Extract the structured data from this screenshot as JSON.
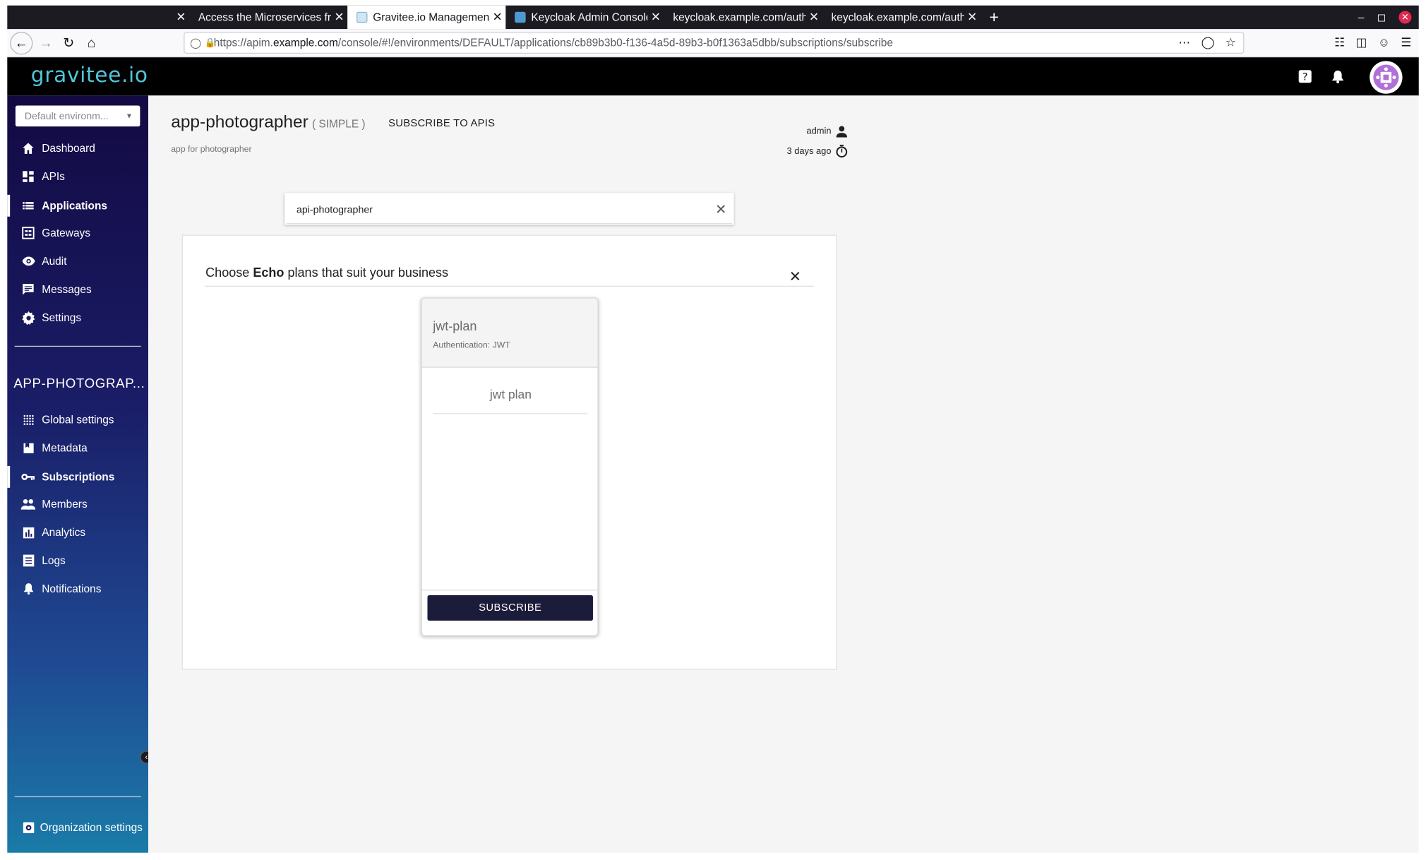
{
  "browser": {
    "tabs": [
      {
        "title": "",
        "active": false
      },
      {
        "title": "Access the Microservices fr",
        "active": false
      },
      {
        "title": "Gravitee.io Management",
        "active": true
      },
      {
        "title": "Keycloak Admin Console",
        "active": false
      },
      {
        "title": "keycloak.example.com/auth",
        "active": false
      },
      {
        "title": "keycloak.example.com/auth",
        "active": false
      }
    ],
    "url_prefix": "https://apim.",
    "url_host": "example.com",
    "url_path": "/console/#!/environments/DEFAULT/applications/cb89b3b0-f136-4a5d-89b3-b0f1363a5dbb/subscriptions/subscribe",
    "close_glyph": "✕",
    "new_tab_glyph": "+"
  },
  "header": {
    "brand": "gravitee.io",
    "colors": {
      "brand": "#51c6da",
      "header_bg": "#000000",
      "sidebar_top": "#130a43",
      "sidebar_bottom": "#1a7ba8",
      "primary_button": "#1b1b3a"
    }
  },
  "sidebar": {
    "environment": "Default environm...",
    "main_items": [
      {
        "label": "Dashboard",
        "icon": "home-icon"
      },
      {
        "label": "APIs",
        "icon": "dashboard-grid-icon"
      },
      {
        "label": "Applications",
        "icon": "list-icon",
        "active": true
      },
      {
        "label": "Gateways",
        "icon": "gateways-icon"
      },
      {
        "label": "Audit",
        "icon": "eye-icon"
      },
      {
        "label": "Messages",
        "icon": "message-icon"
      },
      {
        "label": "Settings",
        "icon": "gear-icon"
      }
    ],
    "app_section_title": "APP-PHOTOGRAP...",
    "app_items": [
      {
        "label": "Global settings",
        "icon": "dots-grid-icon"
      },
      {
        "label": "Metadata",
        "icon": "bookmark-icon"
      },
      {
        "label": "Subscriptions",
        "icon": "key-icon",
        "active": true
      },
      {
        "label": "Members",
        "icon": "people-icon"
      },
      {
        "label": "Analytics",
        "icon": "bar-chart-icon"
      },
      {
        "label": "Logs",
        "icon": "document-icon"
      },
      {
        "label": "Notifications",
        "icon": "bell-icon"
      }
    ],
    "org_settings": "Organization settings"
  },
  "app": {
    "name": "app-photographer",
    "type": "( SIMPLE )",
    "subscribe_link": "SUBSCRIBE TO APIS",
    "description": "app for photographer",
    "owner": "admin",
    "created": "3 days ago"
  },
  "search": {
    "value": "api-photographer"
  },
  "plans": {
    "heading_prefix": "Choose ",
    "api_name": "Echo",
    "heading_suffix": " plans that suit your business",
    "items": [
      {
        "name": "jwt-plan",
        "auth": "Authentication: JWT",
        "description": "jwt plan",
        "button": "SUBSCRIBE"
      }
    ]
  }
}
